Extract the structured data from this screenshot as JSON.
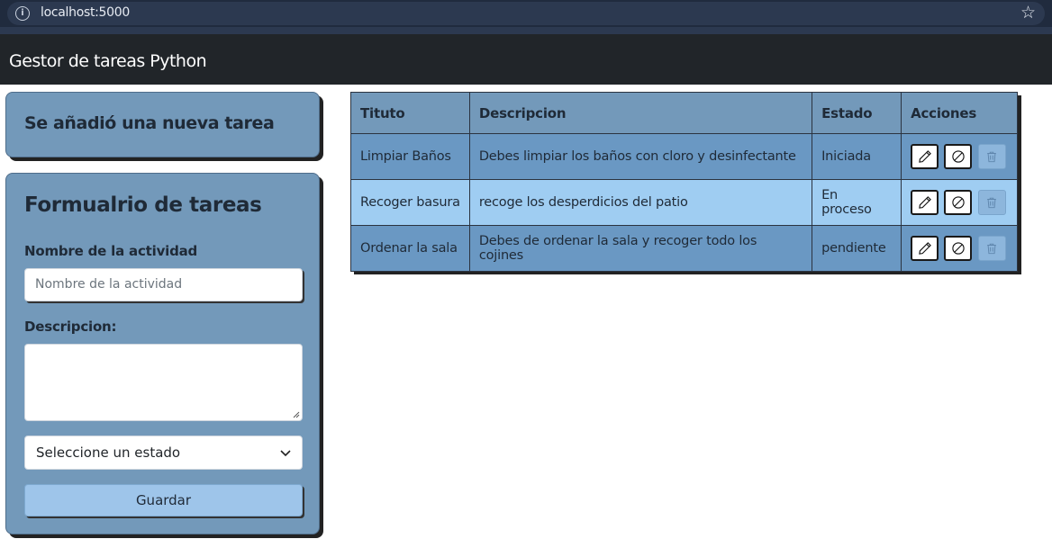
{
  "browser": {
    "url": "localhost:5000",
    "info_icon": "info-icon",
    "bookmark_icon": "star-icon"
  },
  "navbar": {
    "brand": "Gestor de tareas Python"
  },
  "alert": {
    "message": "Se añadió una nueva tarea"
  },
  "form": {
    "title": "Formualrio de tareas",
    "name_label": "Nombre de la actividad",
    "name_placeholder": "Nombre de la actividad",
    "name_value": "",
    "description_label": "Descripcion:",
    "description_value": "",
    "status_select": "Seleccione un estado",
    "save_label": "Guardar"
  },
  "table": {
    "headers": [
      "Tituto",
      "Descripcion",
      "Estado",
      "Acciones"
    ],
    "rows": [
      {
        "title": "Limpiar Baños",
        "description": "Debes limpiar los baños con cloro y desinfectante",
        "status": "Iniciada"
      },
      {
        "title": "Recoger basura",
        "description": "recoge los desperdicios del patio",
        "status": "En proceso"
      },
      {
        "title": "Ordenar la sala",
        "description": "Debes de ordenar la sala y recoger todo los cojines",
        "status": "pendiente"
      }
    ],
    "action_icons": [
      "pencil-icon",
      "block-icon",
      "trash-icon"
    ]
  },
  "colors": {
    "card_bg": "#7399ba",
    "row_alt": "#9fcdf2",
    "row_main": "#6a98c3",
    "navbar": "#212529",
    "save_button": "#9ec5ea"
  }
}
